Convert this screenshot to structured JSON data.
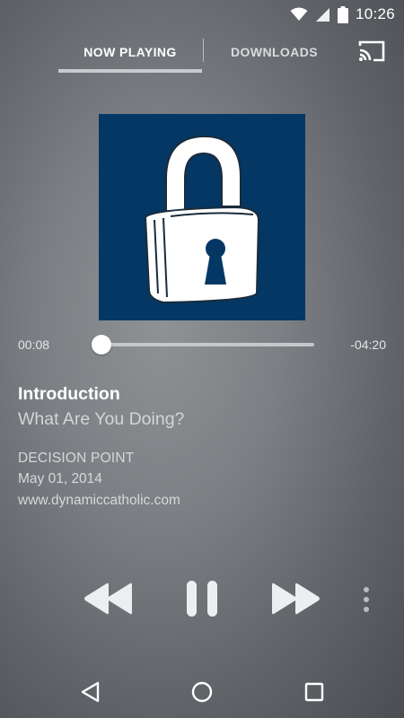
{
  "status_bar": {
    "time": "10:26",
    "icons": [
      "wifi-icon",
      "cell-signal-icon",
      "battery-icon"
    ]
  },
  "tabs": [
    {
      "label": "NOW PLAYING",
      "selected": true
    },
    {
      "label": "DOWNLOADS",
      "selected": false
    }
  ],
  "cast_icon": "cast-icon",
  "artwork": {
    "icon": "padlock-icon",
    "background": "#043763"
  },
  "player": {
    "elapsed": "00:08",
    "remaining": "-04:20",
    "progress_fraction": 0.03
  },
  "episode": {
    "chapter": "Introduction",
    "title": "What Are You Doing?",
    "album": "DECISION POINT",
    "date": "May 01, 2014",
    "url": "www.dynamiccatholic.com"
  },
  "controls": [
    "rewind-icon",
    "pause-icon",
    "fast-forward-icon",
    "more-vert-icon"
  ],
  "nav_bar": [
    "back-icon",
    "home-icon",
    "recents-icon"
  ]
}
